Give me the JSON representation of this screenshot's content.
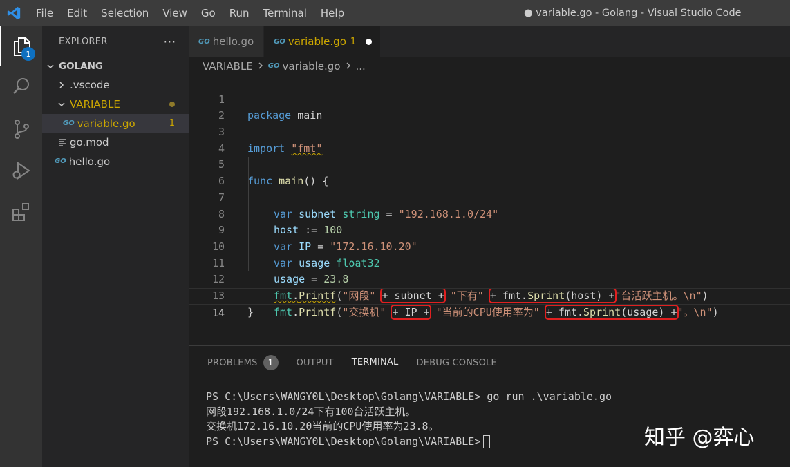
{
  "titlebar": {
    "menu": [
      "File",
      "Edit",
      "Selection",
      "View",
      "Go",
      "Run",
      "Terminal",
      "Help"
    ],
    "title": "● variable.go - Golang - Visual Studio Code"
  },
  "activity": {
    "explorer_badge": "1"
  },
  "sidebar": {
    "header": "EXPLORER",
    "more": "···",
    "root": "GOLANG",
    "items": [
      {
        "label": ".vscode"
      },
      {
        "label": "VARIABLE"
      },
      {
        "label": "variable.go",
        "count": "1"
      },
      {
        "label": "go.mod"
      },
      {
        "label": "hello.go"
      }
    ]
  },
  "tabs": [
    {
      "label": "hello.go"
    },
    {
      "label": "variable.go",
      "count": "1"
    }
  ],
  "go_icon": "GO",
  "breadcrumb": {
    "folder": "VARIABLE",
    "file": "variable.go",
    "more": "..."
  },
  "code": {
    "line_numbers": [
      "1",
      "2",
      "3",
      "4",
      "5",
      "6",
      "7",
      "8",
      "9",
      "10",
      "11",
      "12",
      "13",
      "14"
    ],
    "l1": {
      "kw": "package",
      "name": " main"
    },
    "l3": {
      "kw": "import",
      "sp": " ",
      "str": "\"fmt\""
    },
    "l5": {
      "kw": "func",
      "fn": " main",
      "rest": "() {"
    },
    "l6": {
      "kw": "var",
      "id": " subnet",
      "ty": " string",
      "eq": " = ",
      "str": "\"192.168.1.0/24\""
    },
    "l7": {
      "id": "host",
      "op": " := ",
      "num": "100"
    },
    "l8": {
      "kw": "var",
      "id": " IP",
      "eq": " = ",
      "str": "\"172.16.10.20\""
    },
    "l9": {
      "kw": "var",
      "id": " usage",
      "ty": " float32"
    },
    "l10": {
      "id": "usage",
      "eq": " = ",
      "num": "23.8"
    },
    "l11": {
      "pkg": "fmt",
      "dot": ".",
      "fn": "Printf",
      "open": "(",
      "s1": "\"网段\"",
      "h1": "+ subnet +",
      "s2": "\"下有\"",
      "h2a": "+ fmt.",
      "h2fn": "Sprint",
      "h2b": "(host) +",
      "s3": "\"台活跃主机。\\n\"",
      "close": ")"
    },
    "l12": {
      "pkg": "fmt",
      "dot": ".",
      "fn": "Printf",
      "open": "(",
      "s1": "\"交换机\"",
      "h1": "+ IP +",
      "s2": "\"当前的CPU使用率为\"",
      "h2a": "+ fmt.",
      "h2fn": "Sprint",
      "h2b": "(usage) +",
      "s3": "\"。\\n\"",
      "close": ")"
    },
    "l13": {
      "text": "}"
    }
  },
  "panel": {
    "tabs": [
      "PROBLEMS",
      "OUTPUT",
      "TERMINAL",
      "DEBUG CONSOLE"
    ],
    "problems_count": "1",
    "terminal_lines": [
      "PS C:\\Users\\WANGY0L\\Desktop\\Golang\\VARIABLE> go run .\\variable.go",
      "网段192.168.1.0/24下有100台活跃主机。",
      "交换机172.16.10.20当前的CPU使用率为23.8。",
      "PS C:\\Users\\WANGY0L\\Desktop\\Golang\\VARIABLE>"
    ]
  },
  "watermark": "知乎 @弈心",
  "colors": {
    "accent": "#0e70c0",
    "warning": "#cca700",
    "highlight_box": "#e02020"
  }
}
